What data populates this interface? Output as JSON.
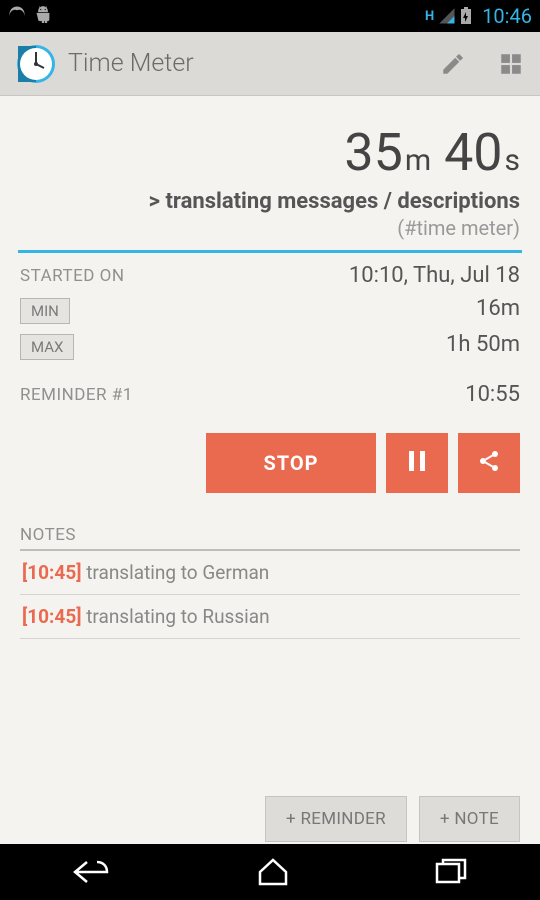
{
  "status": {
    "time": "10:46",
    "network": "H"
  },
  "actionbar": {
    "title": "Time Meter"
  },
  "timer": {
    "minutes": "35",
    "minutes_unit": "m",
    "seconds": "40",
    "seconds_unit": "s"
  },
  "task": {
    "prefix": "> ",
    "name": "translating messages / descriptions",
    "tag": "(#time meter)"
  },
  "started": {
    "label": "STARTED ON",
    "value": "10:10, Thu, Jul 18"
  },
  "min": {
    "label": "MIN",
    "value": "16m"
  },
  "max": {
    "label": "MAX",
    "value": "1h 50m"
  },
  "reminder": {
    "label": "REMINDER #1",
    "value": "10:55"
  },
  "buttons": {
    "stop": "STOP",
    "add_reminder": "+ REMINDER",
    "add_note": "+ NOTE"
  },
  "notes": {
    "header": "NOTES",
    "items": [
      {
        "time": "[10:45]",
        "text": " translating to German"
      },
      {
        "time": "[10:45]",
        "text": " translating to Russian"
      }
    ]
  }
}
